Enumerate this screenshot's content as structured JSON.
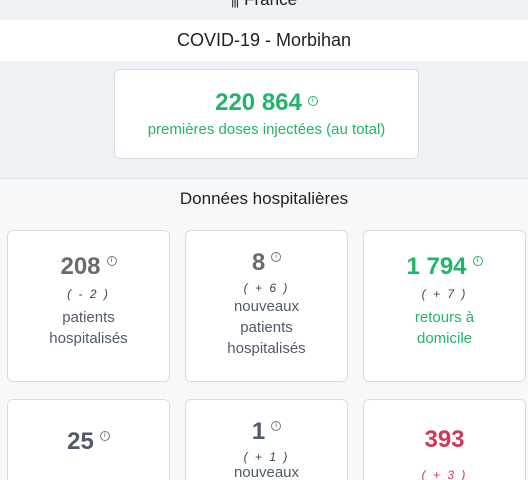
{
  "header": {
    "country_icon": "flag-icon",
    "country": "France",
    "title": "COVID-19 - Morbihan"
  },
  "vaccination": {
    "value": "220 864",
    "label": "premières doses injectées (au total)"
  },
  "hospital": {
    "section_title": "Données hospitalières",
    "cards": [
      {
        "value": "208",
        "delta": "( - 2 )",
        "label": "patients hospitalisés"
      },
      {
        "value": "8",
        "delta": "( + 6 )",
        "label": "nouveaux patients hospitalisés"
      },
      {
        "value": "1 794",
        "delta": "( + 7 )",
        "label": "retours à domicile"
      },
      {
        "value": "25",
        "delta": "",
        "label": ""
      },
      {
        "value": "1",
        "delta": "( + 1 )",
        "label": "nouveaux"
      },
      {
        "value": "393",
        "delta": "( + 3 )",
        "label": ""
      }
    ]
  },
  "colors": {
    "green": "#21b56a",
    "red": "#d2385a",
    "grey": "#6b6b6b"
  }
}
